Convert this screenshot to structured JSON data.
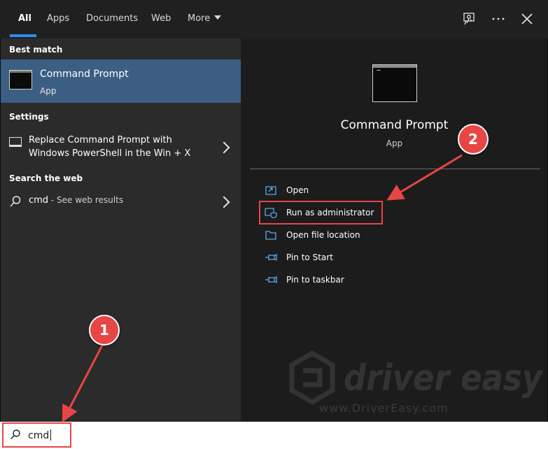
{
  "tabs": [
    {
      "label": "All",
      "active": true
    },
    {
      "label": "Apps"
    },
    {
      "label": "Documents"
    },
    {
      "label": "Web"
    },
    {
      "label": "More"
    }
  ],
  "top_icons": [
    "feedback-icon",
    "more-options-icon",
    "close-icon"
  ],
  "left": {
    "best_match_title": "Best match",
    "best_match": {
      "name": "Command Prompt",
      "type": "App"
    },
    "settings_title": "Settings",
    "setting_line1": "Replace Command Prompt with",
    "setting_line2": "Windows PowerShell in the Win + X",
    "web_title": "Search the web",
    "web_query": "cmd",
    "web_hint": " - See web results"
  },
  "right": {
    "app_name": "Command Prompt",
    "app_type": "App",
    "actions": [
      {
        "label": "Open",
        "icon": "open-icon"
      },
      {
        "label": "Run as administrator",
        "icon": "shield-icon"
      },
      {
        "label": "Open file location",
        "icon": "folder-icon"
      },
      {
        "label": "Pin to Start",
        "icon": "pin-icon"
      },
      {
        "label": "Pin to taskbar",
        "icon": "pin-icon"
      }
    ]
  },
  "watermark": {
    "brand": "driver easy",
    "url": "www.DriverEasy.com"
  },
  "search": {
    "value": "cmd"
  },
  "annotations": [
    {
      "number": "1"
    },
    {
      "number": "2"
    }
  ],
  "colors": {
    "accent": "#2e8ded",
    "highlight": "#3b5e82",
    "annotation": "#e84545"
  }
}
